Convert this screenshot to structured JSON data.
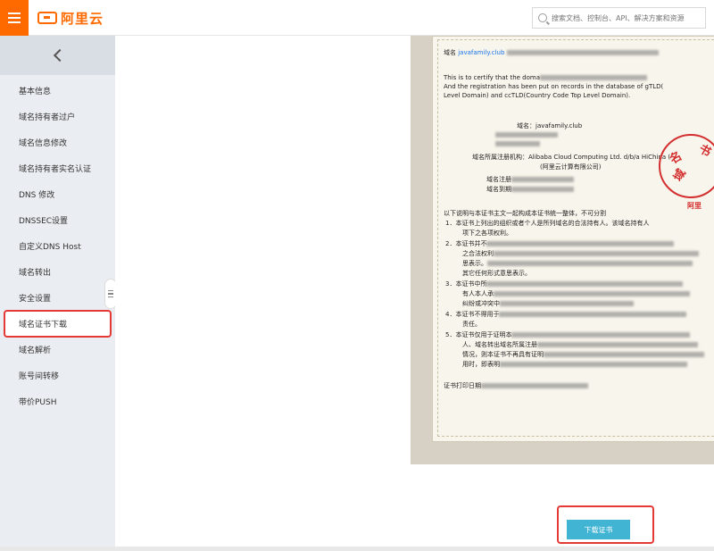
{
  "header": {
    "brand_text": "阿里云",
    "search_placeholder": "搜索文档、控制台、API、解决方案和资源"
  },
  "sidebar": {
    "items": [
      {
        "label": "基本信息"
      },
      {
        "label": "域名持有者过户"
      },
      {
        "label": "域名信息修改"
      },
      {
        "label": "域名持有者实名认证"
      },
      {
        "label": "DNS 修改"
      },
      {
        "label": "DNSSEC设置"
      },
      {
        "label": "自定义DNS Host"
      },
      {
        "label": "域名转出"
      },
      {
        "label": "安全设置"
      },
      {
        "label": "域名证书下载",
        "active": true
      },
      {
        "label": "域名解析"
      },
      {
        "label": "账号间转移"
      },
      {
        "label": "带价PUSH"
      }
    ]
  },
  "certificate": {
    "line1_prefix": "域名",
    "line1_domain": "javafamily.club",
    "line2": "This is to certify that the doma",
    "line3": "And the registration has been put on records in the database of gTLD(",
    "line4": "Level Domain) and ccTLD(Country Code Top Level Domain).",
    "field_domain": "域名：javafamily.club",
    "field_registrar": "域名所属注册机构：Alibaba Cloud Computing Ltd. d/b/a HiChina (",
    "field_registrar_cn": "(阿里云计算有限公司)",
    "field_reg_date": "域名注册",
    "field_exp_date": "域名到期",
    "notes_title": "以下说明与本证书主文一起构成本证书统一整体，不可分割",
    "note1": "1．本证书上列出的组织或者个人是所列域名的合法持有人。该域名持有人",
    "note1b": "项下之各项权利。",
    "note2": "2．本证书并不",
    "note2b": "之合法权利",
    "note2c": "思表示。",
    "note2d": "其它任何形式意思表示。",
    "note3": "3．本证书中所",
    "note3b": "有人本人承",
    "note3c": "纠纷或冲突中",
    "note4": "4．本证书不得用于",
    "note4b": "责任。",
    "note5": "5．本证书仅用于证明本",
    "note5b": "人、域名转出域名所属注册",
    "note5c": "情况，则本证书不再具有证明",
    "note5d": "用时，即表明",
    "print_date": "证书打印日期",
    "seal_chars": [
      "域",
      "名",
      "书"
    ],
    "seal_brand": "阿里"
  },
  "actions": {
    "download_label": "下载证书"
  }
}
